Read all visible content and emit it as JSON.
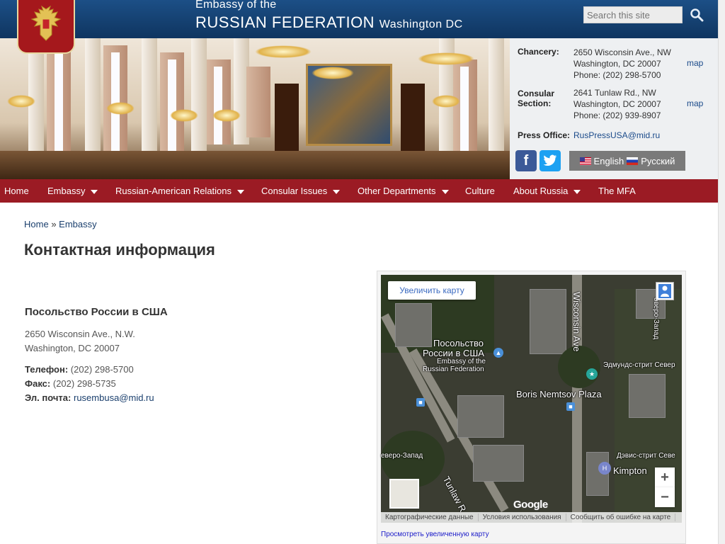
{
  "header": {
    "title_line1": "Embassy of the",
    "title_line2_main": "RUSSIAN FEDERATION",
    "title_line2_small": "Washington DC",
    "search_placeholder": "Search this site"
  },
  "contact_panel": {
    "chancery": {
      "label": "Chancery:",
      "address1": "2650 Wisconsin Ave., NW",
      "address2": "Washington, DC 20007",
      "phone": "Phone: (202) 298-5700",
      "map_link": "map"
    },
    "consular": {
      "label1": "Consular",
      "label2": "Section:",
      "address1": "2641 Tunlaw Rd., NW",
      "address2": "Washington, DC 20007",
      "phone": "Phone: (202) 939-8907",
      "map_link": "map"
    },
    "press": {
      "label": "Press Office:",
      "email": "RusPressUSA@mid.ru"
    },
    "languages": {
      "english": "English",
      "russian": "Русский"
    }
  },
  "nav": {
    "items": [
      {
        "label": "Home"
      },
      {
        "label": "Embassy"
      },
      {
        "label": "Russian-American Relations"
      },
      {
        "label": "Consular Issues"
      },
      {
        "label": "Other Departments"
      },
      {
        "label": "Culture"
      },
      {
        "label": "About Russia"
      },
      {
        "label": "The MFA"
      }
    ]
  },
  "breadcrumb": {
    "home": "Home",
    "separator": "»",
    "current": "Embassy"
  },
  "page": {
    "title": "Контактная информация",
    "org_title": "Посольство России в США",
    "address1": "2650 Wisconsin Ave., N.W.",
    "address2": "Washington, DC 20007",
    "phone_label": "Телефон:",
    "phone": "(202) 298-5700",
    "fax_label": "Факс:",
    "fax": "(202) 298-5735",
    "email_label": "Эл. почта:",
    "email": "rusembusa@mid.ru"
  },
  "map": {
    "enlarge_button": "Увеличить карту",
    "labels": {
      "embassy_ru1": "Посольство",
      "embassy_ru2": "России в США",
      "embassy_en1": "Embassy of the",
      "embassy_en2": "Russian Federation",
      "wisconsin": "Wisconsin Ave",
      "nemtsov": "Boris Nemtsov Plaza",
      "edmunds": "Эдмундс-стрит Север",
      "davis": "Дэвис-стрит Севе",
      "kimpton": "Kimpton",
      "severo_zapad_left": "еверо-Запад",
      "severo_zapad_right": "оверо-Запад",
      "tunlaw": "Tunlaw R"
    },
    "zoom_in": "+",
    "zoom_out": "−",
    "google": "Google",
    "attribution": {
      "data": "Картографические данные",
      "terms": "Условия использования",
      "report": "Сообщить об ошибке на карте"
    },
    "view_larger": "Просмотреть увеличенную карту"
  },
  "colors": {
    "header_blue": "#1c4f86",
    "nav_red": "#9b1b24",
    "panel_bg": "#eef0f2",
    "link_blue": "#1a4a8a"
  },
  "icons": [
    "eagle-crest-icon",
    "search-icon",
    "facebook-icon",
    "twitter-icon",
    "us-flag-icon",
    "russia-flag-icon",
    "pegman-icon",
    "map-pin-icon",
    "bus-stop-icon",
    "hotel-icon"
  ]
}
